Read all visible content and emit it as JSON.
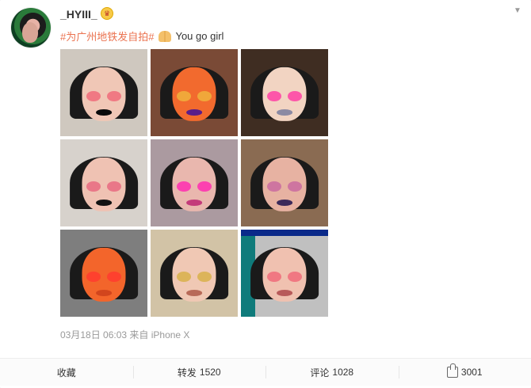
{
  "user": {
    "name": "_HYIII_",
    "badge_icon": "crown-icon",
    "avatar_icon": "avatar"
  },
  "post": {
    "hashtag": "#为广州地铁发自拍#",
    "emoji_icon": "praying-hands-icon",
    "text": "You go girl",
    "timestamp": "03月18日 06:03 来自 iPhone X"
  },
  "photos": [
    {
      "name": "selfie-1",
      "bg": "#cfc8bf",
      "face": "#f0c7b6",
      "lips": "#0a0a0a",
      "blush": "#f06b7a"
    },
    {
      "name": "selfie-2",
      "bg": "#7a4a36",
      "face": "#f26a2e",
      "lips": "#5a1d8a",
      "blush": "#f0b23c"
    },
    {
      "name": "selfie-3",
      "bg": "#3f2d22",
      "face": "#f2d4c2",
      "lips": "#8c8aa3",
      "blush": "#ff3fa4"
    },
    {
      "name": "selfie-4",
      "bg": "#d7d2cc",
      "face": "#efc2b3",
      "lips": "#121212",
      "blush": "#e86a80"
    },
    {
      "name": "selfie-5",
      "bg": "#ab9aa0",
      "face": "#e9b7ae",
      "lips": "#c43b7a",
      "blush": "#ff2db0"
    },
    {
      "name": "selfie-6",
      "bg": "#8a6b52",
      "face": "#e7b2a2",
      "lips": "#3c2a5a",
      "blush": "#c96aa0"
    },
    {
      "name": "selfie-7",
      "bg": "#7e7e7e",
      "face": "#f3652b",
      "lips": "#d2451d",
      "blush": "#ff3b2f"
    },
    {
      "name": "selfie-8",
      "bg": "#d2c3a6",
      "face": "#f0c8b4",
      "lips": "#b86a58",
      "blush": "#d8b04a"
    },
    {
      "name": "selfie-9",
      "bg": "#c0c0c0",
      "face": "#f0c1b0",
      "lips": "#b85a5a",
      "blush": "#f06b7a"
    }
  ],
  "actions": {
    "collect": "收藏",
    "repost_label": "转发",
    "repost_count": "1520",
    "comment_label": "评论",
    "comment_count": "1028",
    "like_count": "3001"
  },
  "colors": {
    "hashtag": "#eb7350",
    "text": "#333333",
    "meta": "#999999"
  }
}
